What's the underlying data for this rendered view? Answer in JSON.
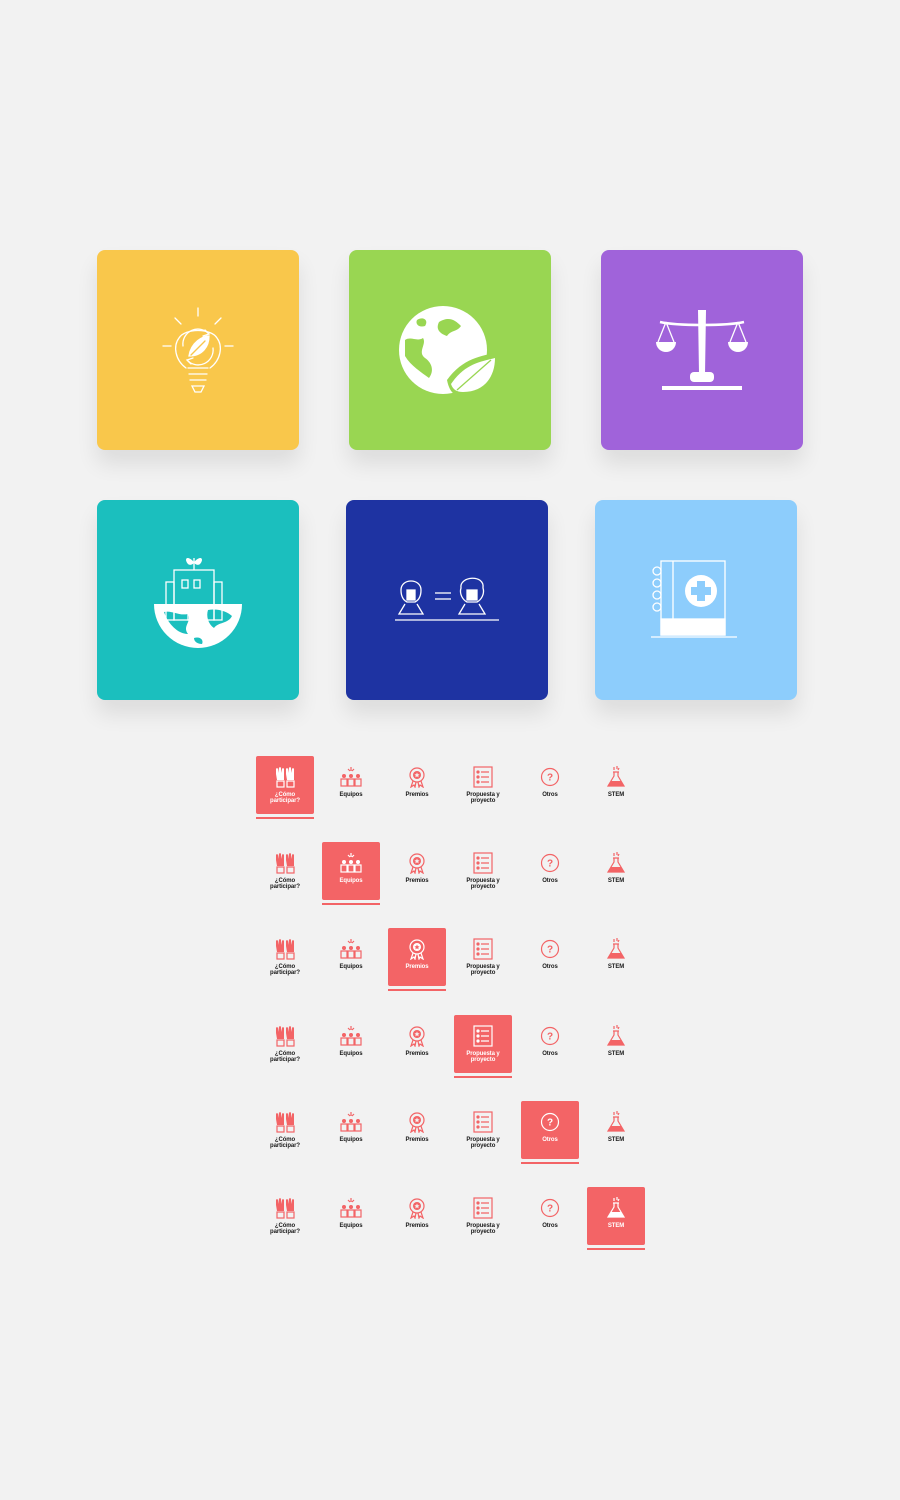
{
  "colors": {
    "background": "#f2f2f2",
    "tile_yellow": "#f9c74b",
    "tile_green": "#99d652",
    "tile_purple": "#a063da",
    "tile_teal": "#1bbfbe",
    "tile_navy": "#1e33a2",
    "tile_lightblue": "#8dcdfc",
    "accent_coral": "#f36466"
  },
  "tiles": [
    {
      "icon": "lightbulb-leaf-icon"
    },
    {
      "icon": "earth-leaf-icon"
    },
    {
      "icon": "balance-scale-icon"
    },
    {
      "icon": "city-on-globe-icon"
    },
    {
      "icon": "people-equality-icon"
    },
    {
      "icon": "medical-notebook-icon"
    }
  ],
  "tab_labels": [
    "¿Cómo\nparticipar?",
    "Equipos",
    "Premios",
    "Propuesta y\nproyecto",
    "Otros",
    "STEM"
  ],
  "tab_icons": [
    "raised-hands-icon",
    "team-icon",
    "award-ribbon-icon",
    "proposal-list-icon",
    "question-circle-icon",
    "flask-icon"
  ],
  "tab_rows": [
    {
      "active_index": 0
    },
    {
      "active_index": 1
    },
    {
      "active_index": 2
    },
    {
      "active_index": 3
    },
    {
      "active_index": 4
    },
    {
      "active_index": 5
    }
  ]
}
